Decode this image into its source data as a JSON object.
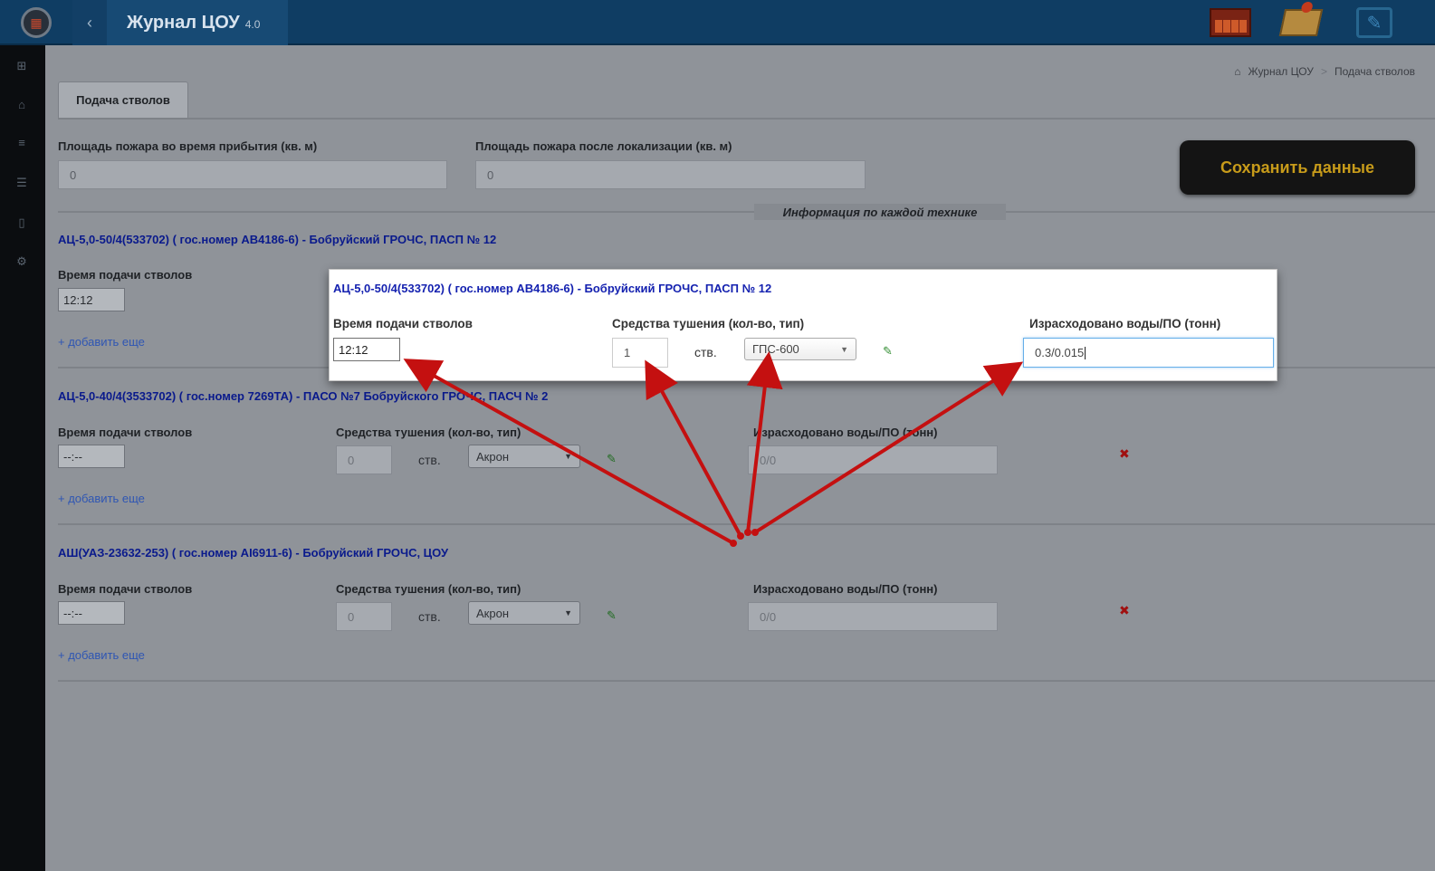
{
  "header": {
    "app_title": "Журнал ЦОУ",
    "version": "4.0"
  },
  "breadcrumb": [
    "Журнал ЦОУ",
    "Подача стволов"
  ],
  "tab_label": "Подача стволов",
  "area_on_arrival": {
    "label": "Площадь пожара во время прибытия (кв. м)",
    "value": "0"
  },
  "area_after_localization": {
    "label": "Площадь пожара после локализации (кв. м)",
    "value": "0"
  },
  "save_button": "Сохранить данные",
  "section_heading": "Информация по каждой технике",
  "field_labels": {
    "time": "Время подачи стволов",
    "means": "Средства тушения (кол-во, тип)",
    "water": "Израсходовано воды/ПО (тонн)",
    "unit": "ств.",
    "add_more": "+ добавить еще"
  },
  "vehicles": [
    {
      "title": "АЦ-5,0-50/4(533702)  ( гос.номер АВ4186-6)  -  Бобруйский ГРОЧС, ПАСП № 12",
      "time": "12:12"
    },
    {
      "title": "АЦ-5,0-40/4(3533702)  ( гос.номер 7269ТА)  -  ПАСО №7 Бобруйского ГРОЧС, ПАСЧ № 2",
      "time": "--:--",
      "qty": "0",
      "agent": "Акрон",
      "water": "0/0"
    },
    {
      "title": "АШ(УАЗ-23632-253)  ( гос.номер АI6911-6)  -  Бобруйский ГРОЧС, ЦОУ",
      "time": "--:--",
      "qty": "0",
      "agent": "Акрон",
      "water": "0/0"
    }
  ],
  "popup": {
    "title": "АЦ-5,0-50/4(533702)  ( гос.номер АВ4186-6)  -  Бобруйский ГРОЧС, ПАСП № 12",
    "time": "12:12",
    "qty": "1",
    "agent": "ГПС-600",
    "water": "0.3/0.015"
  },
  "colors": {
    "topbar": "#0f3d63",
    "save_text": "#c79b1a",
    "arrow": "#c41010",
    "vehicle_link": "#1522b0"
  }
}
